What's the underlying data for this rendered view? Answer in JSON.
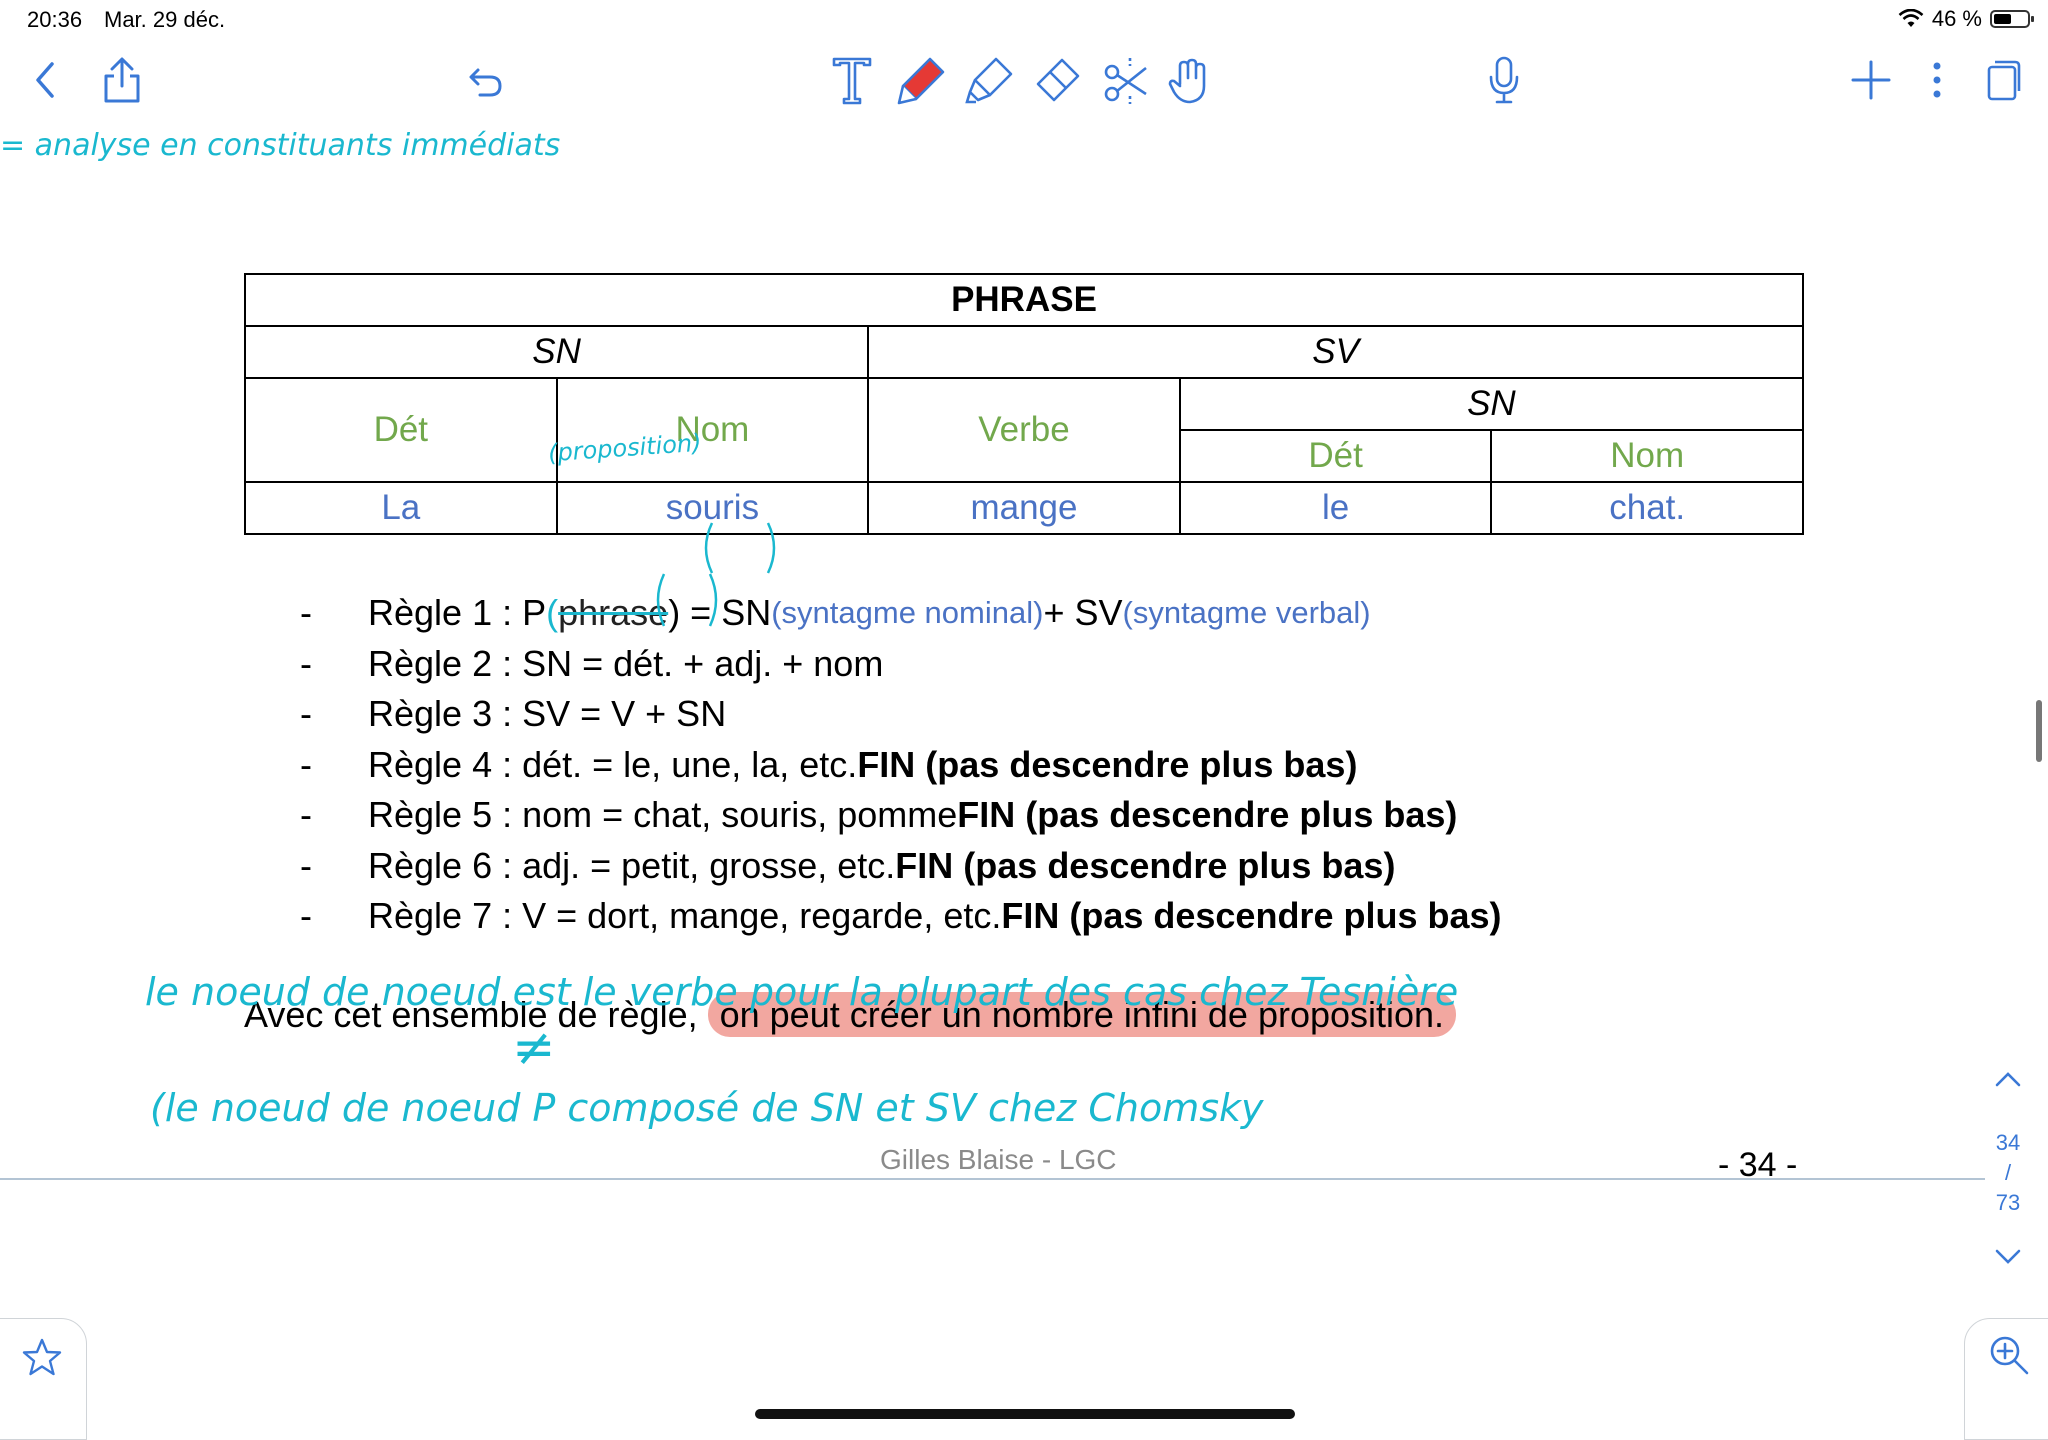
{
  "status": {
    "time": "20:36",
    "date": "Mar. 29 déc.",
    "battery": "46 %",
    "battery_level": 0.46
  },
  "document": {
    "table": {
      "title": "PHRASE",
      "sn": "SN",
      "sv": "SV",
      "sn_inner": "SN",
      "det": "Dét",
      "nom": "Nom",
      "verbe": "Verbe",
      "det2": "Dét",
      "nom2": "Nom",
      "w1": "La",
      "w2": "souris",
      "w3": "mange",
      "w4": "le",
      "w5": "chat."
    },
    "rules": [
      {
        "dash": "-",
        "main": "Règle 1 : P ",
        "struck": "phrase",
        "rest": ") = SN ",
        "note1": "(syntagme nominal)",
        "mid": " + SV ",
        "note2": "(syntagme verbal)"
      },
      {
        "dash": "-",
        "text": "Règle 2 : SN = dét. + adj. + nom"
      },
      {
        "dash": "-",
        "text": "Règle 3 : SV = V + SN"
      },
      {
        "dash": "-",
        "text": "Règle 4 : dét. = le, une, la, etc. ",
        "bold": "FIN (pas descendre plus bas)"
      },
      {
        "dash": "-",
        "text": "Règle 5 : nom = chat, souris, pomme ",
        "bold": "FIN (pas descendre plus bas)"
      },
      {
        "dash": "-",
        "text": "Règle 6 : adj. = petit, grosse, etc. ",
        "bold": "FIN (pas descendre plus bas)"
      },
      {
        "dash": "-",
        "text": "Règle 7 : V = dort, mange, regarde, etc. ",
        "bold": "FIN (pas descendre plus bas)"
      }
    ],
    "conclusion_start": "Avec cet ensemble de règle, ",
    "conclusion_highlight": "on peut créer un nombre infini de proposition.",
    "footer_author": "Gilles Blaise - LGC",
    "page_number": "- 34 -"
  },
  "handwriting": {
    "top": "= analyse en constituants immédiats",
    "proposition": "(proposition)",
    "line1": "le noeud de noeud est le verbe pour la plupart des cas chez Tesnière",
    "neq": "≠",
    "line2": "(le noeud de noeud P composé de SN et SV chez Chomsky"
  },
  "pager": {
    "current": "34",
    "sep": "/",
    "total": "73"
  },
  "colors": {
    "accent": "#3a78d6",
    "ink": "#1ab8cf",
    "highlight": "#f2a7a0",
    "pen_red": "#e53935"
  },
  "icons": [
    "back-chevron-icon",
    "share-icon",
    "undo-icon",
    "text-tool-icon",
    "pen-icon",
    "highlighter-icon",
    "eraser-icon",
    "lasso-scissors-icon",
    "hand-pointer-icon",
    "microphone-icon",
    "add-page-icon",
    "more-icon",
    "pages-sidebar-icon",
    "star-icon",
    "zoom-icon",
    "chevron-up-icon",
    "chevron-down-icon"
  ]
}
